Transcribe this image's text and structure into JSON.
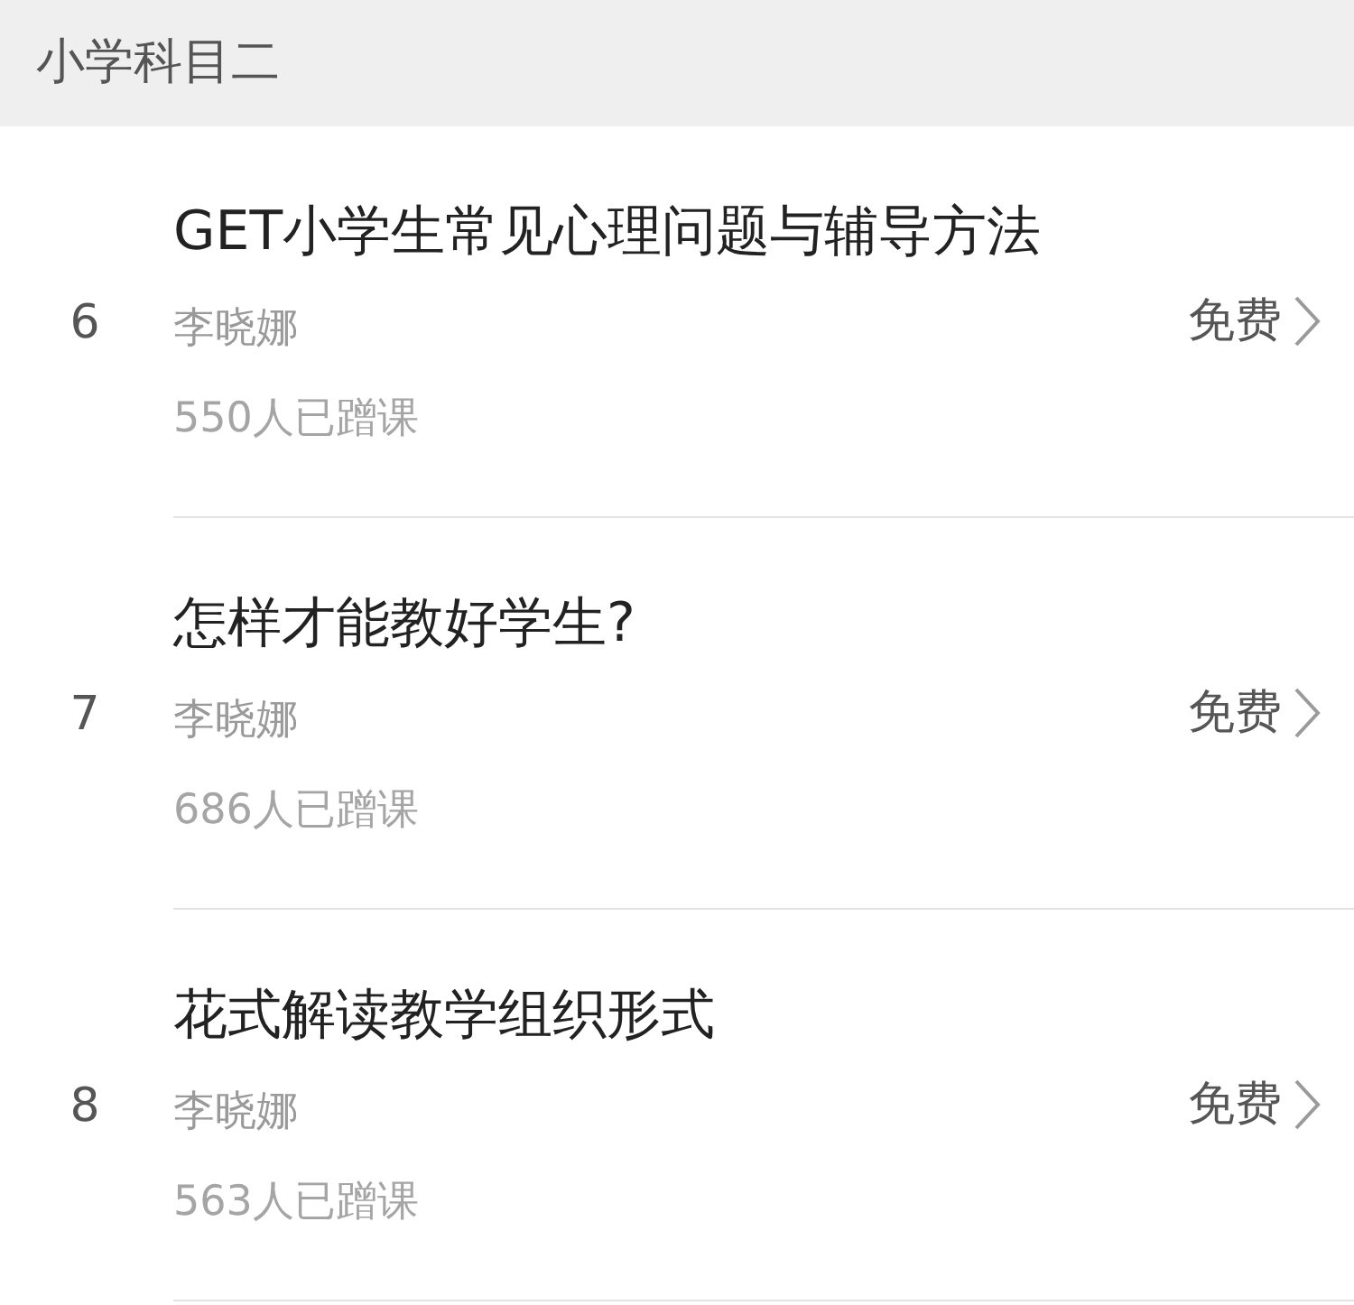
{
  "header": {
    "title": "小学科目二"
  },
  "courses": [
    {
      "index": "6",
      "title": "GET小学生常见心理问题与辅导方法",
      "teacher": "李晓娜",
      "enrolled": "550人已蹭课",
      "price": "免费"
    },
    {
      "index": "7",
      "title": "怎样才能教好学生?",
      "teacher": "李晓娜",
      "enrolled": "686人已蹭课",
      "price": "免费"
    },
    {
      "index": "8",
      "title": "花式解读教学组织形式",
      "teacher": "李晓娜",
      "enrolled": "563人已蹭课",
      "price": "免费"
    }
  ]
}
